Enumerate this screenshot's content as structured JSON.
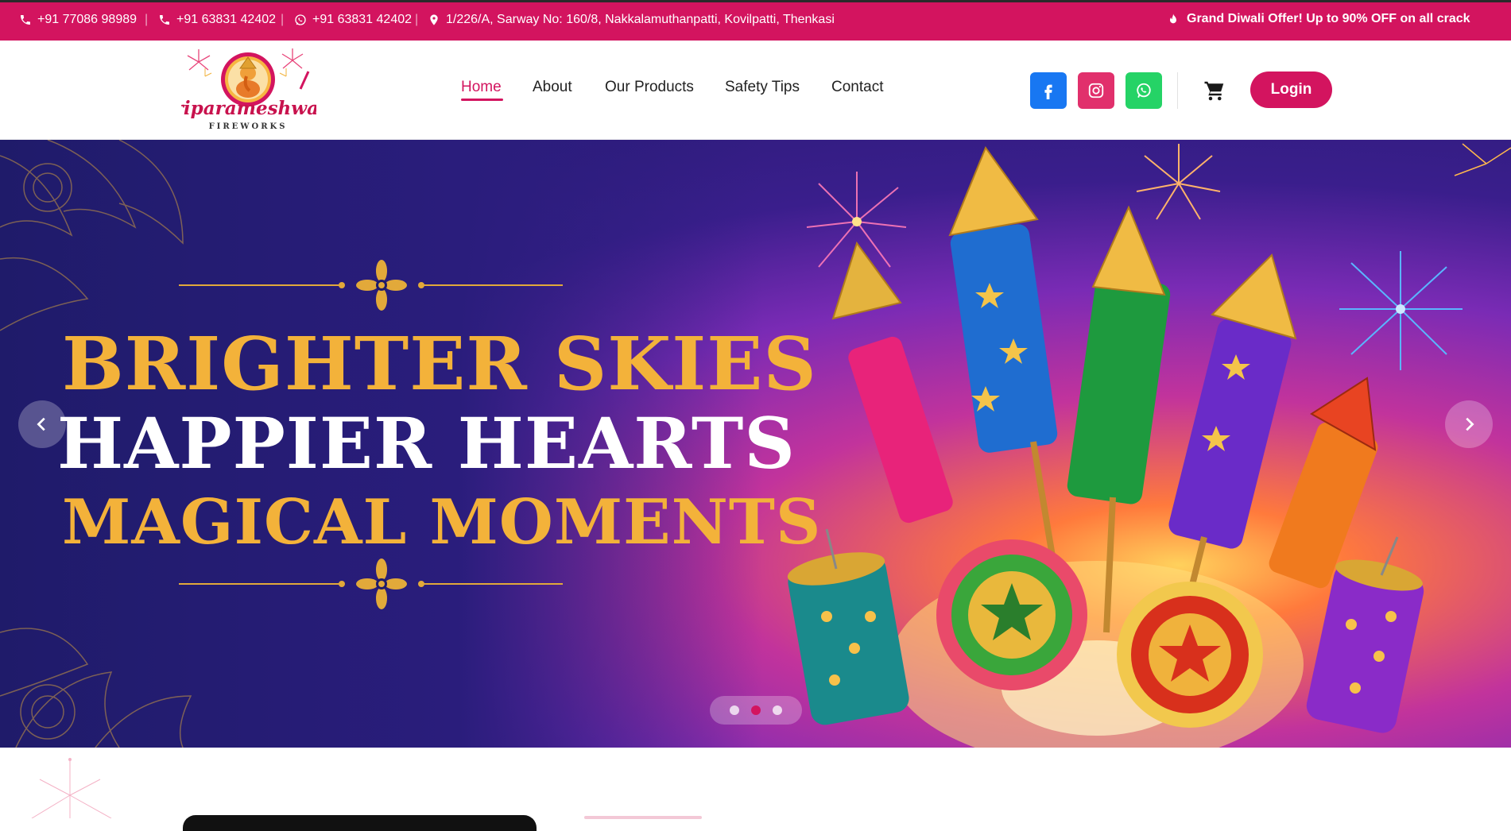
{
  "topbar": {
    "phone1": "+91 77086 98989",
    "phone2": "+91 63831 42402",
    "whatsapp": "+91 63831 42402",
    "address": "1/226/A, Sarway No: 160/8, Nakkalamuthanpatti, Kovilpatti, Thenkasi",
    "separator": "|",
    "offer": "Grand Diwali Offer! Up to 90% OFF on all crack",
    "icons": [
      "phone-icon",
      "phone-icon",
      "whatsapp-icon",
      "location-pin-icon",
      "fire-icon"
    ]
  },
  "header": {
    "logo": {
      "name": "Sriparameshwari",
      "sub": "FIREWORKS"
    },
    "nav": [
      {
        "label": "Home",
        "active": true
      },
      {
        "label": "About"
      },
      {
        "label": "Our Products"
      },
      {
        "label": "Safety Tips"
      },
      {
        "label": "Contact"
      }
    ],
    "social": [
      {
        "name": "facebook",
        "color": "#1877f2"
      },
      {
        "name": "instagram",
        "color": "#e1306c"
      },
      {
        "name": "whatsapp",
        "color": "#25d366"
      }
    ],
    "login_label": "Login"
  },
  "hero": {
    "line1": "BRIGHTER SKIES",
    "line2": "HAPPIER HEARTS",
    "line3": "MAGICAL MOMENTS",
    "slide_count": 3,
    "active_slide": 2
  },
  "colors": {
    "brand": "#d3145f",
    "gold": "#f3b23a",
    "hero_bg": "#241a6e"
  }
}
